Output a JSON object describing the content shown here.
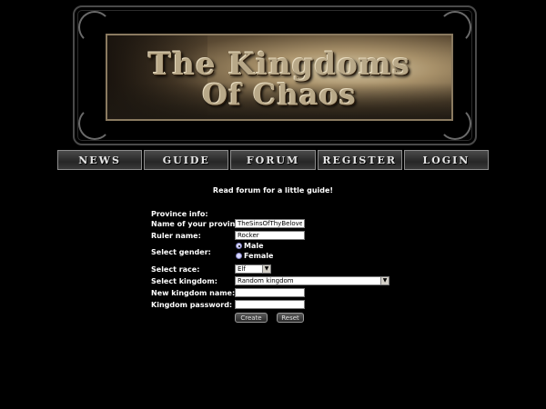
{
  "banner": {
    "line1": "The Kingdoms",
    "line2": "Of Chaos"
  },
  "nav": {
    "items": [
      "NEWS",
      "GUIDE",
      "FORUM",
      "REGISTER",
      "LOGIN"
    ]
  },
  "guide_text": "Read forum for a little guide!",
  "form": {
    "section_label": "Province info:",
    "province_label": "Name of your province:",
    "province_value": "TheSinsOfThyBeloved",
    "ruler_label": "Ruler name:",
    "ruler_value": "Rocker",
    "gender_label": "Select gender:",
    "gender_options": [
      "Male",
      "Female"
    ],
    "gender_selected": "Male",
    "race_label": "Select race:",
    "race_value": "Elf",
    "kingdom_label": "Select kingdom:",
    "kingdom_value": "Random kingdom",
    "new_kingdom_label": "New kingdom name:",
    "new_kingdom_value": "",
    "password_label": "Kingdom password:",
    "password_value": "",
    "create_button": "Create",
    "reset_button": "Reset"
  }
}
